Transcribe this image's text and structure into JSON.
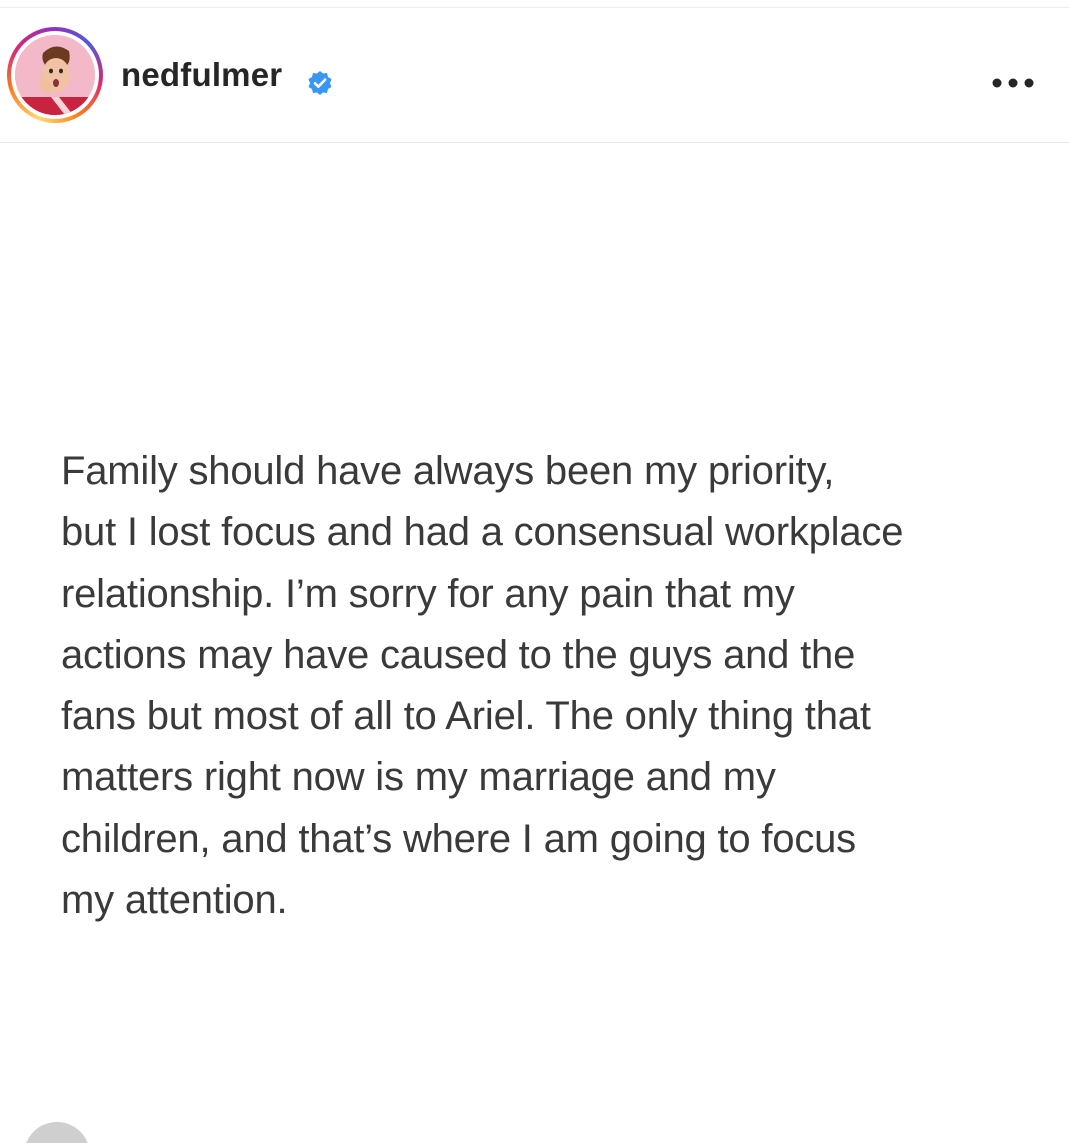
{
  "post": {
    "header": {
      "username": "nedfulmer",
      "verified": true,
      "avatar_icon": "profile-photo",
      "more_icon": "more-options-icon",
      "story_ring_colors": [
        "#feda75",
        "#fa7e1e",
        "#d62976",
        "#962fbf",
        "#4f5bd5"
      ],
      "verified_color": "#3897f0"
    },
    "body": {
      "text": "Family should have always been my priority,\nbut I lost focus and had a consensual workplace\nrelationship.  I’m sorry for any pain that my\nactions may have caused to the guys and the\nfans but most of all to Ariel. The only thing that\nmatters right now is my marriage and my\nchildren, and that’s where I am going to focus\nmy attention."
    }
  }
}
